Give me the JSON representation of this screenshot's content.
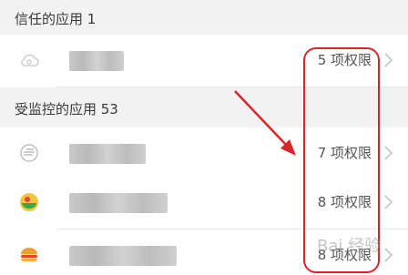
{
  "sections": {
    "trusted": {
      "title": "信任的应用 1"
    },
    "monitored": {
      "title": "受监控的应用 53"
    }
  },
  "rows": [
    {
      "permissions": "5 项权限",
      "icon": "cloud-icon"
    },
    {
      "permissions": "7 项权限",
      "icon": "browser-icon"
    },
    {
      "permissions": "8 项权限",
      "icon": "game-icon"
    },
    {
      "permissions": "8 项权限",
      "icon": "burger-icon"
    }
  ],
  "watermark": "Bai 经验",
  "colors": {
    "annotation": "#d8252a",
    "section_bg": "#f2f2f2"
  }
}
